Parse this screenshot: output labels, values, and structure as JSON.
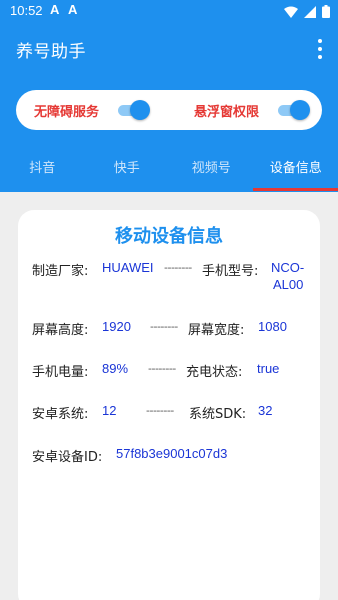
{
  "status_bar": {
    "time": "10:52",
    "indicators": [
      "A",
      "A"
    ]
  },
  "app_bar": {
    "title": "养号助手"
  },
  "permissions": {
    "accessibility": {
      "label": "无障碍服务",
      "enabled": true
    },
    "overlay": {
      "label": "悬浮窗权限",
      "enabled": true
    }
  },
  "tabs": [
    {
      "label": "抖音",
      "active": false
    },
    {
      "label": "快手",
      "active": false
    },
    {
      "label": "视频号",
      "active": false
    },
    {
      "label": "设备信息",
      "active": true
    }
  ],
  "device_card": {
    "title": "移动设备信息",
    "separator": "--------",
    "manufacturer": {
      "label": "制造厂家:",
      "value": "HUAWEI"
    },
    "model": {
      "label": "手机型号:",
      "value_line1": "NCO-",
      "value_line2": "AL00"
    },
    "screen_height": {
      "label": "屏幕高度:",
      "value": "1920"
    },
    "screen_width": {
      "label": "屏幕宽度:",
      "value": "1080"
    },
    "battery": {
      "label": "手机电量:",
      "value": "89%"
    },
    "charging": {
      "label": "充电状态:",
      "value": "true"
    },
    "android_version": {
      "label": "安卓系统:",
      "value": "12"
    },
    "sdk": {
      "label": "系统SDK:",
      "value": "32"
    },
    "android_id": {
      "label": "安卓设备ID:",
      "value": "57f8b3e9001c07d3"
    }
  },
  "colors": {
    "primary": "#1e90ee",
    "warning": "#e53935",
    "value": "#1a35d6"
  }
}
